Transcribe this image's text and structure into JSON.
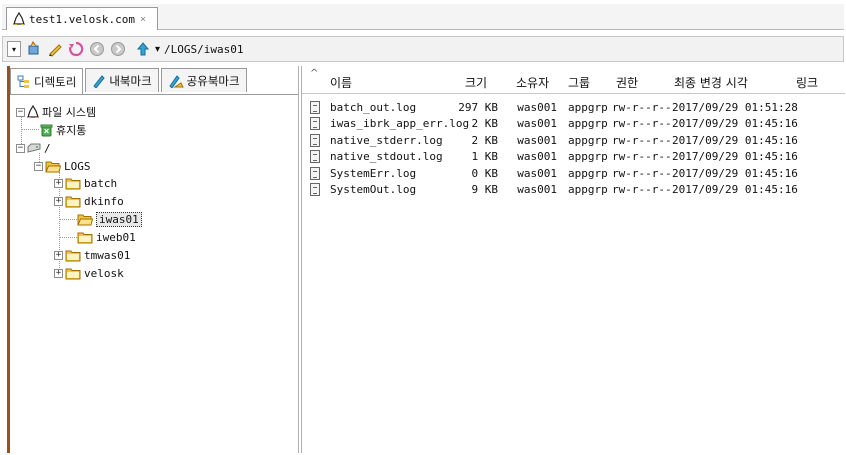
{
  "tab": {
    "title": "test1.velosk.com",
    "close_glyph": "×"
  },
  "toolbar": {
    "path": "/LOGS/iwas01",
    "dropdown_glyph": "▾",
    "history_glyph": "▾"
  },
  "left_tabs": [
    {
      "label": "디렉토리",
      "icon": "directory-icon",
      "active": true
    },
    {
      "label": "내북마크",
      "icon": "bookmark-icon",
      "active": false
    },
    {
      "label": "공유북마크",
      "icon": "shared-bookmark-icon",
      "active": false
    }
  ],
  "tree": {
    "root": {
      "label": "파일 시스템",
      "expander": "−"
    },
    "trash": {
      "label": "휴지통"
    },
    "slash": {
      "label": "/",
      "expander": "−"
    },
    "logs": {
      "label": "LOGS",
      "expander": "−"
    },
    "children": [
      {
        "label": "batch",
        "expander": "+"
      },
      {
        "label": "dkinfo",
        "expander": "+"
      },
      {
        "label": "iwas01",
        "expander": "",
        "selected": true
      },
      {
        "label": "iweb01",
        "expander": ""
      },
      {
        "label": "tmwas01",
        "expander": "+"
      },
      {
        "label": "velosk",
        "expander": "+"
      }
    ]
  },
  "columns": {
    "name": "이름",
    "size": "크기",
    "owner": "소유자",
    "group": "그룹",
    "perm": "권한",
    "modified": "최종 변경 시각",
    "link": "링크",
    "sort_glyph": "^"
  },
  "files": [
    {
      "name": "batch_out.log",
      "size": "297 KB",
      "owner": "was001",
      "group": "appgrp",
      "perm": "rw-r--r--",
      "modified": "2017/09/29 01:51:28"
    },
    {
      "name": "iwas_ibrk_app_err.log",
      "size": "2 KB",
      "owner": "was001",
      "group": "appgrp",
      "perm": "rw-r--r--",
      "modified": "2017/09/29 01:45:16"
    },
    {
      "name": "native_stderr.log",
      "size": "2 KB",
      "owner": "was001",
      "group": "appgrp",
      "perm": "rw-r--r--",
      "modified": "2017/09/29 01:45:16"
    },
    {
      "name": "native_stdout.log",
      "size": "1 KB",
      "owner": "was001",
      "group": "appgrp",
      "perm": "rw-r--r--",
      "modified": "2017/09/29 01:45:16"
    },
    {
      "name": "SystemErr.log",
      "size": "0 KB",
      "owner": "was001",
      "group": "appgrp",
      "perm": "rw-r--r--",
      "modified": "2017/09/29 01:45:16"
    },
    {
      "name": "SystemOut.log",
      "size": "9 KB",
      "owner": "was001",
      "group": "appgrp",
      "perm": "rw-r--r--",
      "modified": "2017/09/29 01:45:16"
    }
  ],
  "colors": {
    "accent_border": "#9b4d25",
    "folder": "#f3c343",
    "tux_yellow": "#f2b705"
  }
}
